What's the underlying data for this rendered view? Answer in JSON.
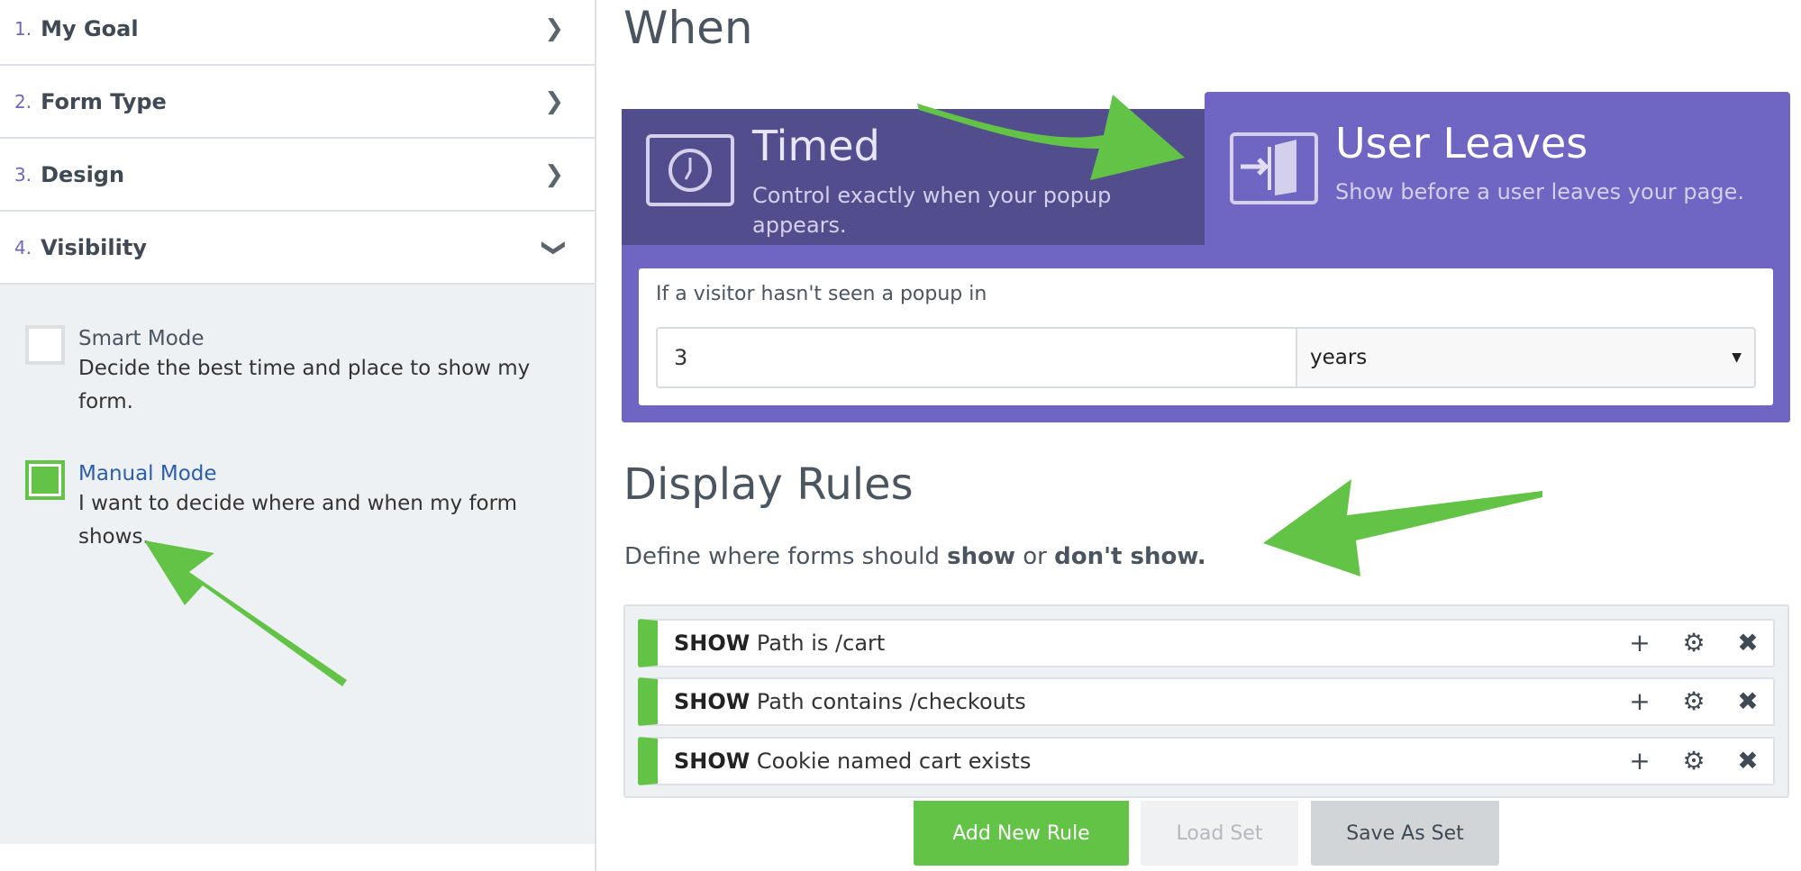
{
  "sidebar": {
    "steps": [
      {
        "num": "1.",
        "label": "My Goal",
        "icon": "chevron-right"
      },
      {
        "num": "2.",
        "label": "Form Type",
        "icon": "chevron-right"
      },
      {
        "num": "3.",
        "label": "Design",
        "icon": "chevron-right"
      },
      {
        "num": "4.",
        "label": "Visibility",
        "icon": "chevron-down"
      }
    ],
    "modes": [
      {
        "title": "Smart Mode",
        "desc": "Decide the best time and place to show my form.",
        "checked": false
      },
      {
        "title": "Manual Mode",
        "desc": "I want to decide where and when my form shows.",
        "checked": true
      }
    ]
  },
  "main": {
    "when_title": "When",
    "tabs": [
      {
        "title": "Timed",
        "desc": "Control exactly when your popup appears.",
        "icon": "clock",
        "active": false
      },
      {
        "title": "User Leaves",
        "desc": "Show before a user leaves your page.",
        "icon": "exit-door",
        "active": true
      }
    ],
    "interval_label": "If a visitor hasn't seen a popup in",
    "interval_value": "3",
    "interval_unit": "years",
    "rules_title": "Display Rules",
    "rules_sub": {
      "pre": "Define where forms should ",
      "show": "show",
      "mid": " or ",
      "dont": "don't show."
    },
    "rules": [
      {
        "action": "SHOW",
        "text": "Path is /cart"
      },
      {
        "action": "SHOW",
        "text": "Path contains /checkouts"
      },
      {
        "action": "SHOW",
        "text": "Cookie named cart exists"
      }
    ],
    "rule_icons": {
      "add": "+",
      "settings": "⚙",
      "remove": "✖"
    },
    "buttons": {
      "add": "Add New Rule",
      "load": "Load Set",
      "save": "Save As Set"
    }
  },
  "colors": {
    "green": "#62c346",
    "purple": "#6e66c2",
    "purple_dark": "#524e8e",
    "link_blue": "#2a5db0"
  }
}
